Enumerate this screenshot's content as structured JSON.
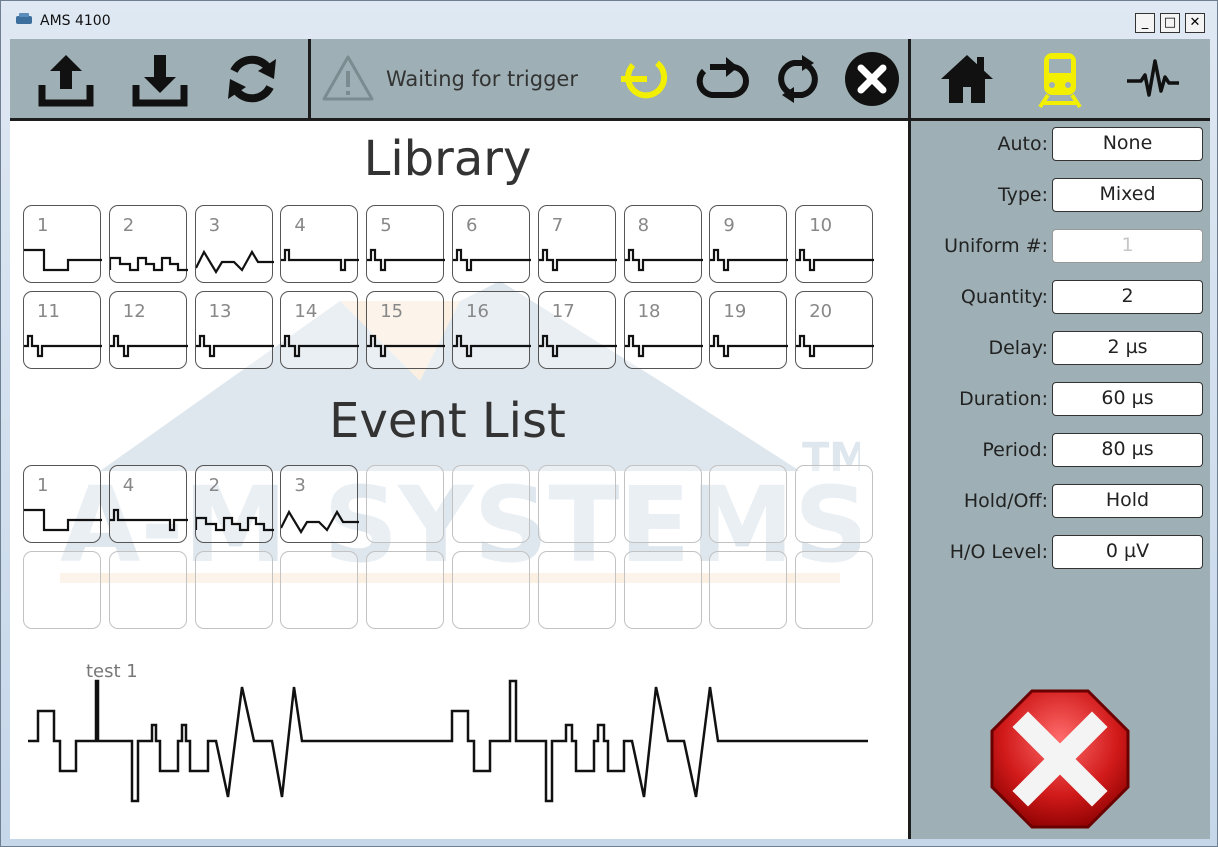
{
  "window": {
    "title": "AMS 4100",
    "min_label": "_",
    "max_label": "□",
    "close_label": "✕"
  },
  "toolbar": {
    "status_text": "Waiting for trigger",
    "colors": {
      "active": "#f2f000",
      "normal": "#111111",
      "warn": "#7b8b90"
    },
    "icons": [
      "upload-icon",
      "download-icon",
      "refresh-icon",
      "warning-icon",
      "trigger-icon",
      "repeat-icon",
      "cycle-icon",
      "stop-circle-icon",
      "home-icon",
      "train-icon",
      "pulse-icon"
    ]
  },
  "library": {
    "title": "Library",
    "tiles": [
      {
        "num": "1",
        "wave": "A"
      },
      {
        "num": "2",
        "wave": "B"
      },
      {
        "num": "3",
        "wave": "C"
      },
      {
        "num": "4",
        "wave": "D"
      },
      {
        "num": "5",
        "wave": "E"
      },
      {
        "num": "6",
        "wave": "E"
      },
      {
        "num": "7",
        "wave": "E"
      },
      {
        "num": "8",
        "wave": "E"
      },
      {
        "num": "9",
        "wave": "E"
      },
      {
        "num": "10",
        "wave": "E"
      },
      {
        "num": "11",
        "wave": "E"
      },
      {
        "num": "12",
        "wave": "E"
      },
      {
        "num": "13",
        "wave": "E"
      },
      {
        "num": "14",
        "wave": "E"
      },
      {
        "num": "15",
        "wave": "E"
      },
      {
        "num": "16",
        "wave": "E"
      },
      {
        "num": "17",
        "wave": "E"
      },
      {
        "num": "18",
        "wave": "E"
      },
      {
        "num": "19",
        "wave": "E"
      },
      {
        "num": "20",
        "wave": "E"
      }
    ]
  },
  "event_list": {
    "title": "Event List",
    "tiles": [
      {
        "num": "1",
        "wave": "A"
      },
      {
        "num": "4",
        "wave": "D"
      },
      {
        "num": "2",
        "wave": "B"
      },
      {
        "num": "3",
        "wave": "C"
      },
      {
        "num": "",
        "wave": ""
      },
      {
        "num": "",
        "wave": ""
      },
      {
        "num": "",
        "wave": ""
      },
      {
        "num": "",
        "wave": ""
      },
      {
        "num": "",
        "wave": ""
      },
      {
        "num": "",
        "wave": ""
      },
      {
        "num": "",
        "wave": ""
      },
      {
        "num": "",
        "wave": ""
      },
      {
        "num": "",
        "wave": ""
      },
      {
        "num": "",
        "wave": ""
      },
      {
        "num": "",
        "wave": ""
      },
      {
        "num": "",
        "wave": ""
      },
      {
        "num": "",
        "wave": ""
      },
      {
        "num": "",
        "wave": ""
      },
      {
        "num": "",
        "wave": ""
      },
      {
        "num": "",
        "wave": ""
      }
    ]
  },
  "trace": {
    "label": "test 1"
  },
  "watermark": {
    "text": "A-M SYSTEMS",
    "tm": "TM"
  },
  "properties": [
    {
      "label": "Auto:",
      "value": "None",
      "disabled": false
    },
    {
      "label": "Type:",
      "value": "Mixed",
      "disabled": false
    },
    {
      "label": "Uniform #:",
      "value": "1",
      "disabled": true
    },
    {
      "label": "Quantity:",
      "value": "2",
      "disabled": false
    },
    {
      "label": "Delay:",
      "value": "2 µs",
      "disabled": false
    },
    {
      "label": "Duration:",
      "value": "60 µs",
      "disabled": false
    },
    {
      "label": "Period:",
      "value": "80 µs",
      "disabled": false
    },
    {
      "label": "Hold/Off:",
      "value": "Hold",
      "disabled": false
    },
    {
      "label": "H/O Level:",
      "value": "0 µV",
      "disabled": false
    }
  ]
}
